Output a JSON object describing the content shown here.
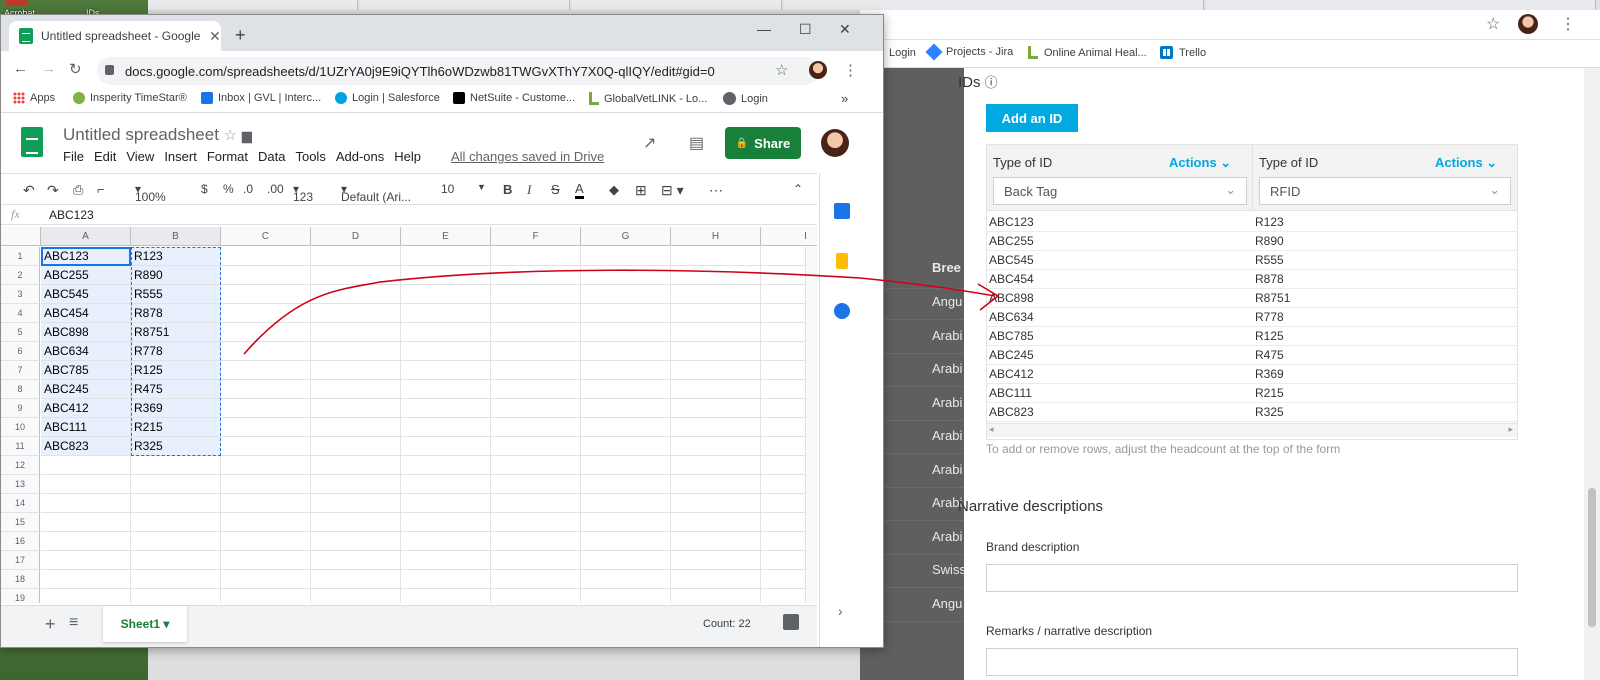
{
  "desktop": {
    "icon1_label": "Acrobat",
    "icon2_label": "IDs"
  },
  "bg_browser": {
    "bookmarks": [
      "Login",
      "Projects - Jira",
      "Online Animal Heal...",
      "Trello"
    ],
    "breed_header": "Bree",
    "breed_rows": [
      "Angu",
      "Arabi",
      "Arabi",
      "Arabi",
      "Arabi",
      "Arabi",
      "Arabi",
      "Arabi",
      "Swiss",
      "Angu"
    ]
  },
  "sheets_window": {
    "tab_title": "Untitled spreadsheet - Google S",
    "url": "docs.google.com/spreadsheets/d/1UZrYA0j9E9iQYTlh6oWDzwb81TWGvXThY7X0Q-qlIQY/edit#gid=0",
    "bookmarks": [
      "Apps",
      "Insperity TimeStar®",
      "Inbox | GVL | Interc...",
      "Login | Salesforce",
      "NetSuite - Custome...",
      "GlobalVetLINK - Lo...",
      "Login"
    ],
    "doc_title": "Untitled spreadsheet",
    "menus": [
      "File",
      "Edit",
      "View",
      "Insert",
      "Format",
      "Data",
      "Tools",
      "Add-ons",
      "Help"
    ],
    "saved_status": "All changes saved in Drive",
    "share_label": "Share",
    "toolbar": {
      "zoom": "100%",
      "currency": "$",
      "percent": "%",
      "dec_less": ".0",
      "dec_more": ".00",
      "num_format": "123",
      "font": "Default (Ari...",
      "font_size": "10",
      "bold": "B",
      "italic": "I",
      "strike": "S",
      "text_color": "A",
      "more": "⋯"
    },
    "fx_label": "fx",
    "formula_value": "ABC123",
    "columns": [
      "A",
      "B",
      "C",
      "D",
      "E",
      "F",
      "G",
      "H",
      "I"
    ],
    "rows": [
      "1",
      "2",
      "3",
      "4",
      "5",
      "6",
      "7",
      "8",
      "9",
      "10",
      "11",
      "12",
      "13",
      "14",
      "15",
      "16",
      "17",
      "18",
      "19"
    ],
    "cells_a": [
      "ABC123",
      "ABC255",
      "ABC545",
      "ABC454",
      "ABC898",
      "ABC634",
      "ABC785",
      "ABC245",
      "ABC412",
      "ABC111",
      "ABC823"
    ],
    "cells_b": [
      "R123",
      "R890",
      "R555",
      "R878",
      "R8751",
      "R778",
      "R125",
      "R475",
      "R369",
      "R215",
      "R325"
    ],
    "sheet_tab": "Sheet1",
    "count": "Count: 22"
  },
  "form": {
    "ids_title": "IDs",
    "info_icon": "ⓘ",
    "add_id_label": "Add an ID",
    "col1_header": "Type of ID",
    "col1_actions": "Actions",
    "col1_type": "Back Tag",
    "col2_header": "Type of ID",
    "col2_actions": "Actions",
    "col2_type": "RFID",
    "ids_a": [
      "ABC123",
      "ABC255",
      "ABC545",
      "ABC454",
      "ABC898",
      "ABC634",
      "ABC785",
      "ABC245",
      "ABC412",
      "ABC111",
      "ABC823"
    ],
    "ids_b": [
      "R123",
      "R890",
      "R555",
      "R878",
      "R8751",
      "R778",
      "R125",
      "R475",
      "R369",
      "R215",
      "R325"
    ],
    "hint": "To add or remove rows, adjust the headcount at the top of the form",
    "narrative_title": "Narrative descriptions",
    "brand_label": "Brand description",
    "remarks_label": "Remarks / narrative description"
  },
  "colors": {
    "sheets_green": "#188038",
    "accent_blue": "#00a9e0",
    "arrow_red": "#d0021b",
    "selection": "#e8f0fe"
  }
}
